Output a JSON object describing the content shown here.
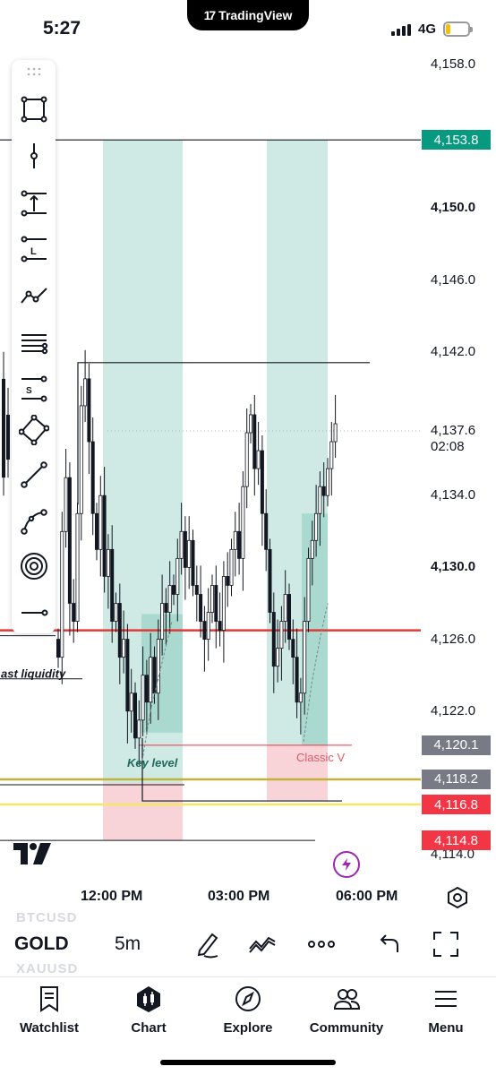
{
  "status_bar": {
    "time": "5:27",
    "network": "4G",
    "app_pill": "TradingView"
  },
  "price_scale": {
    "labels": [
      {
        "text": "4,158.0",
        "bold": false,
        "price": 4158.0
      },
      {
        "text": "4,150.0",
        "bold": true,
        "price": 4150.0
      },
      {
        "text": "4,146.0",
        "bold": false,
        "price": 4146.0
      },
      {
        "text": "4,142.0",
        "bold": false,
        "price": 4142.0
      },
      {
        "text": "4,134.0",
        "bold": false,
        "price": 4134.0
      },
      {
        "text": "4,130.0",
        "bold": true,
        "price": 4130.0
      },
      {
        "text": "4,126.0",
        "bold": false,
        "price": 4126.0
      },
      {
        "text": "4,122.0",
        "bold": false,
        "price": 4122.0
      },
      {
        "text": "4,114.0",
        "bold": false,
        "price": 4114.0
      }
    ],
    "tags": [
      {
        "text": "4,153.8",
        "color": "#089981",
        "price": 4153.8
      },
      {
        "text": "4,120.1",
        "color": "#787b86",
        "price": 4120.1
      },
      {
        "text": "4,118.2",
        "color": "#787b86",
        "price": 4118.2
      },
      {
        "text": "4,116.8",
        "color": "#f23645",
        "price": 4116.8
      },
      {
        "text": "4,114.8",
        "color": "#f23645",
        "price": 4114.8
      }
    ],
    "last_price": "4,137.6",
    "countdown": "02:08"
  },
  "annotations": {
    "last_liquidity": "ast liquidity",
    "key_level": "Key level",
    "classic_v": "Classic V"
  },
  "time_axis": [
    "12:00 PM",
    "03:00 PM",
    "06:00 PM"
  ],
  "symbol_bar": {
    "symbol": "GOLD",
    "interval": "5m",
    "ghost_top": "BTCUSD",
    "ghost_bottom": "XAUUSD"
  },
  "tabs": [
    {
      "label": "Watchlist",
      "icon": "bookmark-icon"
    },
    {
      "label": "Chart",
      "icon": "chart-icon"
    },
    {
      "label": "Explore",
      "icon": "compass-icon"
    },
    {
      "label": "Community",
      "icon": "people-icon"
    },
    {
      "label": "Menu",
      "icon": "menu-icon"
    }
  ],
  "colors": {
    "long_zone": "#cfeae4",
    "short_zone": "#f8d4d8",
    "support_line": "#e53935",
    "yellow_line": "#f5e663",
    "olive_line": "#c2b23a"
  },
  "chart_data": {
    "type": "candlestick",
    "symbol": "GOLD",
    "interval": "5m",
    "x_ticks": [
      "12:00 PM",
      "03:00 PM",
      "06:00 PM"
    ],
    "y_ticks": [
      4158.0,
      4150.0,
      4146.0,
      4142.0,
      4134.0,
      4130.0,
      4126.0,
      4122.0,
      4114.0
    ],
    "ylim": [
      4113.6,
      4158.6
    ],
    "last_price": 4137.6,
    "horizontal_levels": [
      {
        "price": 4153.8,
        "color": "#131722"
      },
      {
        "price": 4141.4,
        "color": "#131722"
      },
      {
        "price": 4126.5,
        "color": "#e53935"
      },
      {
        "price": 4120.1,
        "color": "#f23645"
      },
      {
        "price": 4118.2,
        "color": "#c2b23a"
      },
      {
        "price": 4116.8,
        "color": "#f5e663"
      },
      {
        "price": 4114.8,
        "color": "#131722"
      }
    ],
    "price_path": [
      4126.0,
      4125.0,
      4132.0,
      4135.0,
      4128.0,
      4127.0,
      4133.0,
      4139.0,
      4140.5,
      4137.0,
      4133.0,
      4131.0,
      4134.0,
      4129.5,
      4131.0,
      4127.0,
      4128.0,
      4125.0,
      4126.0,
      4122.0,
      4123.0,
      4120.5,
      4121.5,
      4124.0,
      4122.5,
      4125.0,
      4123.0,
      4126.0,
      4128.0,
      4127.5,
      4129.0,
      4128.5,
      4130.5,
      4132.0,
      4130.0,
      4131.5,
      4129.0,
      4128.5,
      4127.0,
      4126.0,
      4127.5,
      4129.0,
      4127.0,
      4126.5,
      4129.5,
      4129.0,
      4131.0,
      4132.0,
      4130.5,
      4134.5,
      4137.5,
      4138.5,
      4135.5,
      4136.5,
      4133.0,
      4131.0,
      4127.5,
      4124.5,
      4125.5,
      4127.0,
      4128.5,
      4126.0,
      4125.0,
      4122.5,
      4123.0,
      4127.0,
      4130.5,
      4131.5,
      4133.0,
      4134.5,
      4134.0,
      4135.5,
      4137.0,
      4138.0
    ]
  }
}
